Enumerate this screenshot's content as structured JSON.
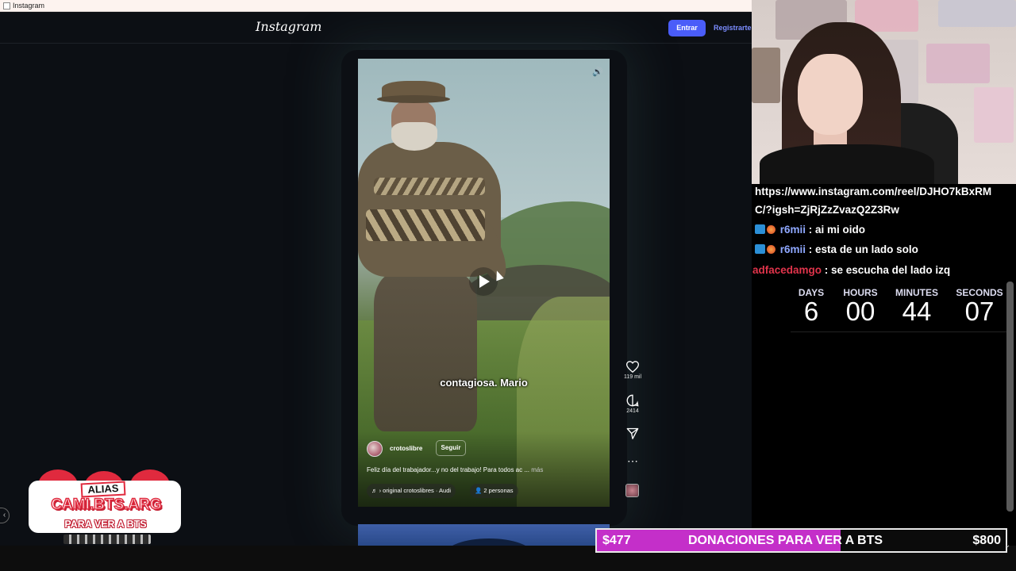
{
  "window": {
    "title": "Instagram"
  },
  "header": {
    "logo": "Instagram",
    "login_label": "Entrar",
    "register_label": "Registrarte"
  },
  "reel": {
    "subtitle": "contagiosa. Mario",
    "username": "crotoslibre",
    "follow_label": "Seguir",
    "caption": "Feliz día del trabajador...y no del trabajo! Para todos ac ...",
    "caption_more": "más",
    "audio_text": "♬ › original   crotoslibres · Audi",
    "people_text": "👤 2 personas",
    "likes": "119 mil",
    "comments": "2414",
    "more_icon": "⋯"
  },
  "chat": {
    "messages": [
      {
        "user": "",
        "text": "https://www.instagram.com/reel/DJHO7kBxRM"
      },
      {
        "user": "",
        "text": "C/?igsh=ZjRjZzZvazQ2Z3Rw"
      },
      {
        "user": "r6mii",
        "text": " : ai mi oido"
      },
      {
        "user": "r6mii",
        "text": " : esta de un lado solo"
      },
      {
        "user": "adfacedamgo",
        "text": " : se escucha del lado izq"
      }
    ]
  },
  "countdown": {
    "days_label": "DAYS",
    "days": "6",
    "hours_label": "HOURS",
    "hours": "00",
    "minutes_label": "MINUTES",
    "minutes": "44",
    "seconds_label": "SECONDS",
    "seconds": "07"
  },
  "donation": {
    "current": "$477",
    "label": "DONACIONES PARA VER A BTS",
    "goal": "$800",
    "progress_fraction": 0.596,
    "fill_color": "#c42fc9"
  },
  "alias": {
    "label": "ALIAS",
    "name": "CAMI.BTS.ARG",
    "sub": "PARA VER A BTS"
  },
  "colors": {
    "accent": "#4a5df9",
    "chat_user": "#8fa8ff",
    "chat_user_red": "#e0344b"
  }
}
